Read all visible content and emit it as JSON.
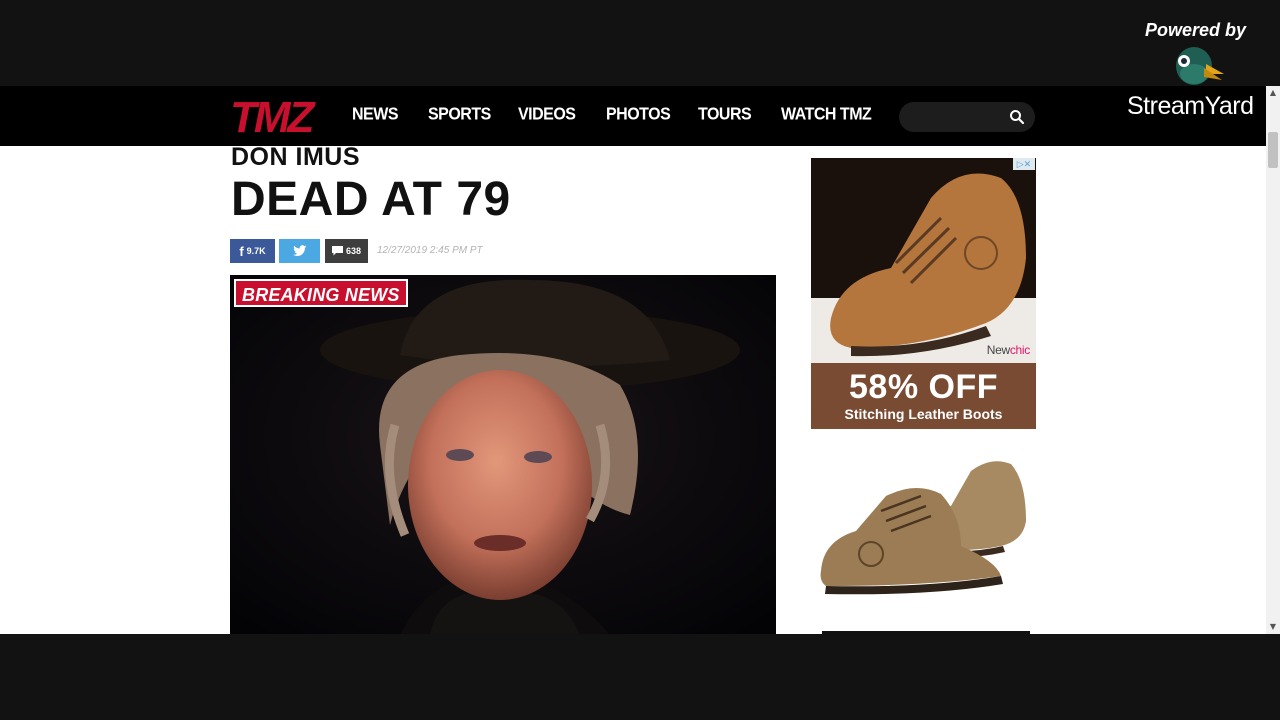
{
  "nav": {
    "logo_text": "TMZ",
    "items": [
      "NEWS",
      "SPORTS",
      "VIDEOS",
      "PHOTOS",
      "TOURS",
      "WATCH TMZ"
    ],
    "search_placeholder": ""
  },
  "article": {
    "kicker": "DON IMUS",
    "headline": "DEAD AT 79",
    "share": {
      "facebook_count": "9.7K",
      "comments_count": "638"
    },
    "timestamp": "12/27/2019 2:45 PM PT",
    "badge": "BREAKING NEWS"
  },
  "ads": {
    "ad1": {
      "brand_prefix": "New",
      "brand_suffix": "chic",
      "offer": "58% OFF",
      "product": "Stitching Leather Boots"
    }
  },
  "overlay": {
    "powered_by": "Powered by",
    "brand": "StreamYard"
  },
  "colors": {
    "tmz_red": "#c8102e",
    "facebook": "#3b5998",
    "twitter": "#4ba8e2",
    "nav_bg": "#000000",
    "ad_band": "#7a4b33"
  }
}
